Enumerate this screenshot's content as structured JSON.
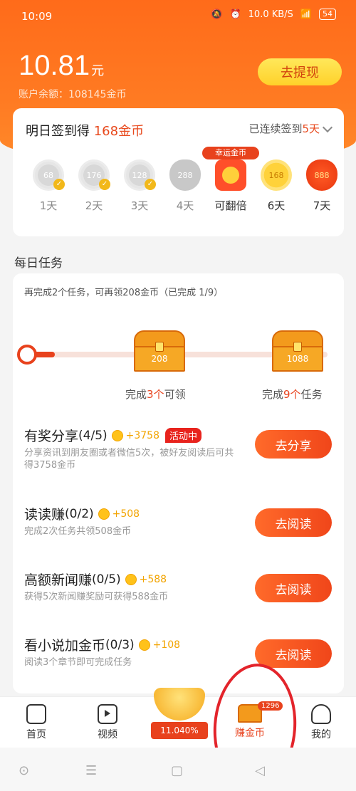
{
  "status": {
    "time": "10:09",
    "speed": "10.0 KB/S",
    "battery": "54"
  },
  "account": {
    "amount": "10.81",
    "unit": "元",
    "balance_label": "账户余额：108145金币",
    "withdraw_label": "去提现"
  },
  "signin": {
    "title_prefix": "明日签到得 ",
    "title_amount": "168金币",
    "streak_prefix": "已连续签到",
    "streak_days": "5天",
    "days": [
      {
        "value": "68",
        "label": "1天"
      },
      {
        "value": "176",
        "label": "2天"
      },
      {
        "value": "128",
        "label": "3天"
      },
      {
        "value": "288",
        "label": "4天"
      },
      {
        "tag": "幸运金币",
        "label": "可翻倍"
      },
      {
        "value": "168",
        "label": "6天"
      },
      {
        "value": "888",
        "label": "7天"
      }
    ]
  },
  "tasks": {
    "section_title": "每日任务",
    "progress_text": "再完成2个任务，可再领208金币（已完成 1/9）",
    "progress_fraction": 0.11,
    "milestones": [
      {
        "coins": "208",
        "label_pre": "完成",
        "label_num": "3个",
        "label_post": "可领"
      },
      {
        "coins": "1088",
        "label_pre": "完成",
        "label_num": "9个",
        "label_post": "任务"
      }
    ],
    "items": [
      {
        "title": "有奖分享",
        "progress": "(4/5)",
        "reward": "+3758",
        "tag": "活动中",
        "desc": "分享资讯到朋友圈或者微信5次，被好友阅读后可共得3758金币",
        "button": "去分享"
      },
      {
        "title": "读读赚",
        "progress": "(0/2)",
        "reward": "+508",
        "desc": "完成2次任务共领508金币",
        "button": "去阅读"
      },
      {
        "title": "高额新闻赚",
        "progress": "(0/5)",
        "reward": "+588",
        "desc": "获得5次新闻赚奖励可获得588金币",
        "button": "去阅读"
      },
      {
        "title": "看小说加金币",
        "progress": "(0/3)",
        "reward": "+108",
        "desc": "阅读3个章节即可完成任务",
        "button": "去阅读"
      }
    ]
  },
  "tabbar": {
    "home": "首页",
    "video": "视频",
    "bowl_pct": "11.040%",
    "earn": "赚金币",
    "earn_badge": "1296",
    "me": "我的"
  },
  "colors": {
    "brand": "#ff6b1a",
    "accent": "#e8421d",
    "gold": "#f2a400"
  }
}
